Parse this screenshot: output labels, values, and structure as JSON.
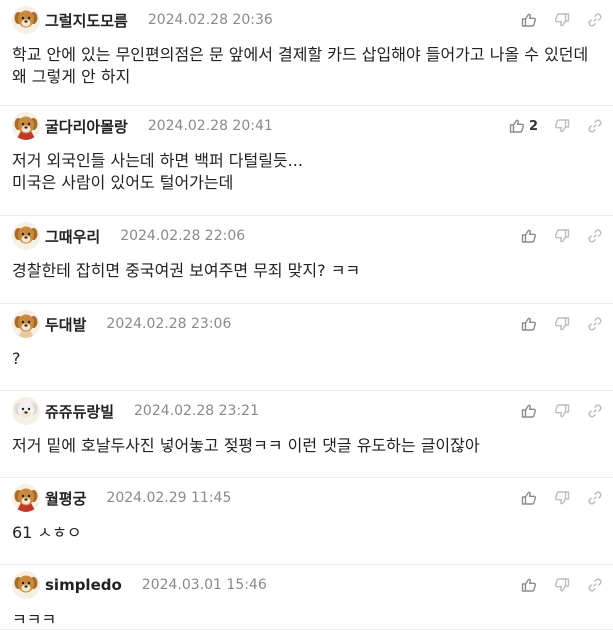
{
  "comments": [
    {
      "nickname": "그럴지도모름",
      "date": "2024.02.28 20:36",
      "text": "학교 안에 있는 무인편의점은 문 앞에서 결제할 카드 삽입해야 들어가고 나올 수 있던데 왜 그렇게 안 하지",
      "likes": "",
      "avatar": "golden-puppy"
    },
    {
      "nickname": "굴다리아몰랑",
      "date": "2024.02.28 20:41",
      "text": "저거 외국인들 사는데 하면 백퍼 다털릴듯...\n미국은 사람이 있어도 털어가는데",
      "likes": "2",
      "avatar": "golden-puppy-cape"
    },
    {
      "nickname": "그때우리",
      "date": "2024.02.28 22:06",
      "text": "경찰한테 잡히면 중국여권 보여주면 무죄 맞지? ㅋㅋ",
      "likes": "",
      "avatar": "golden-puppy"
    },
    {
      "nickname": "두대발",
      "date": "2024.02.28 23:06",
      "text": "?",
      "likes": "",
      "avatar": "golden-puppy-scarf"
    },
    {
      "nickname": "쥬쥬듀랑빌",
      "date": "2024.02.28 23:21",
      "text": "저거 밑에 호날두사진 넣어놓고 젖평ㅋㅋ 이런 댓글 유도하는 글이잖아",
      "likes": "",
      "avatar": "white-puppy"
    },
    {
      "nickname": "월평궁",
      "date": "2024.02.29 11:45",
      "text": "61 ㅅㅎㅇ",
      "likes": "",
      "avatar": "golden-puppy-cape"
    },
    {
      "nickname": "simpledo",
      "date": "2024.03.01 15:46",
      "text": "ㅋㅋㅋ",
      "likes": "",
      "avatar": "golden-puppy"
    }
  ],
  "colors": {
    "golden": "#c98a3e",
    "white": "#f1f1ef",
    "cape": "#c0392b",
    "scarf": "#e8c8a0",
    "icon": "#8c8c8c",
    "icon_light": "#bdbdbd"
  }
}
